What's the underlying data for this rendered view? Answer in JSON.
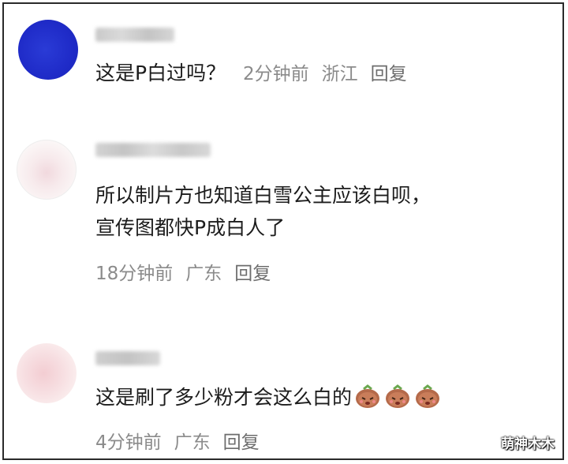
{
  "comments": [
    {
      "text_lines": [
        "这是P白过吗？"
      ],
      "time": "2分钟前",
      "location": "浙江",
      "reply_label": "回复"
    },
    {
      "text_lines": [
        "所以制片方也知道白雪公主应该白呗，",
        "宣传图都快P成白人了"
      ],
      "time": "18分钟前",
      "location": "广东",
      "reply_label": "回复"
    },
    {
      "text_lines": [
        "这是刷了多少粉才会这么白的"
      ],
      "time": "4分钟前",
      "location": "广东",
      "reply_label": "回复",
      "emojis": [
        "facepalm-bag-emoji",
        "facepalm-bag-emoji",
        "facepalm-bag-emoji"
      ]
    }
  ],
  "watermark": "萌神木木",
  "colors": {
    "avatar_blue": "#1f2bc8",
    "meta_gray": "#8b8b8b",
    "text_dark": "#1c1c1c"
  }
}
